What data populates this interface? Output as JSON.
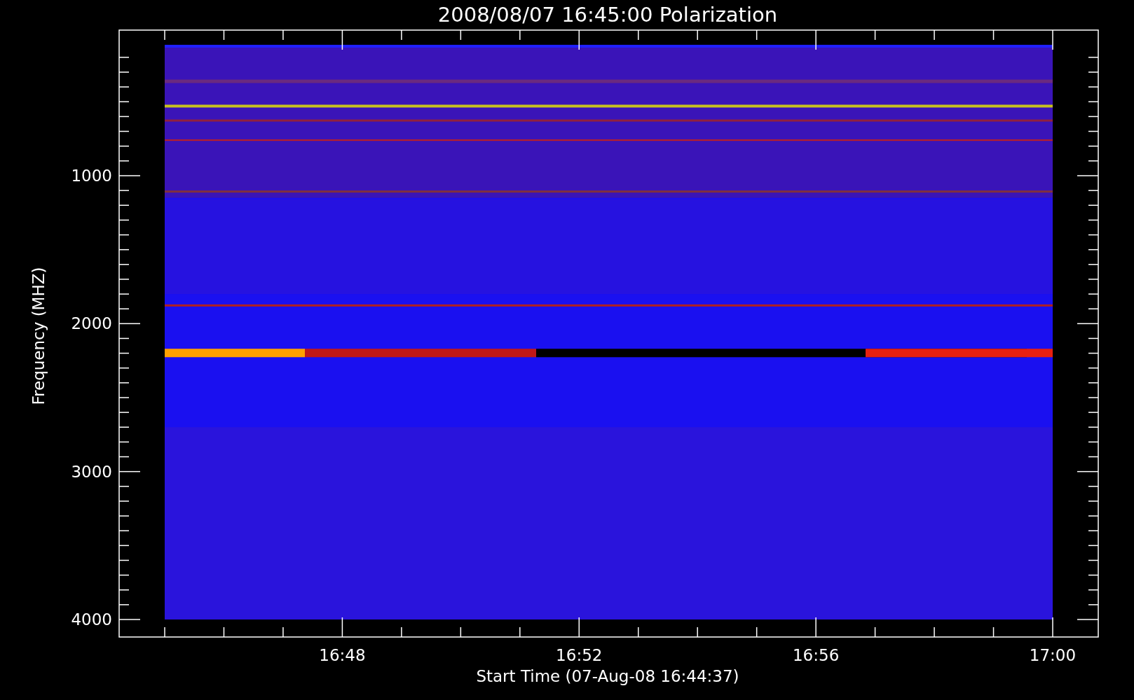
{
  "title": "2008/08/07 16:45:00 Polarization",
  "y_axis": {
    "label": "Frequency (MHZ)",
    "ticks": [
      "1000",
      "2000",
      "3000",
      "4000"
    ]
  },
  "x_axis": {
    "label": "Start Time (07-Aug-08 16:44:37)",
    "ticks": [
      "16:48",
      "16:52",
      "16:56",
      "17:00"
    ]
  }
}
